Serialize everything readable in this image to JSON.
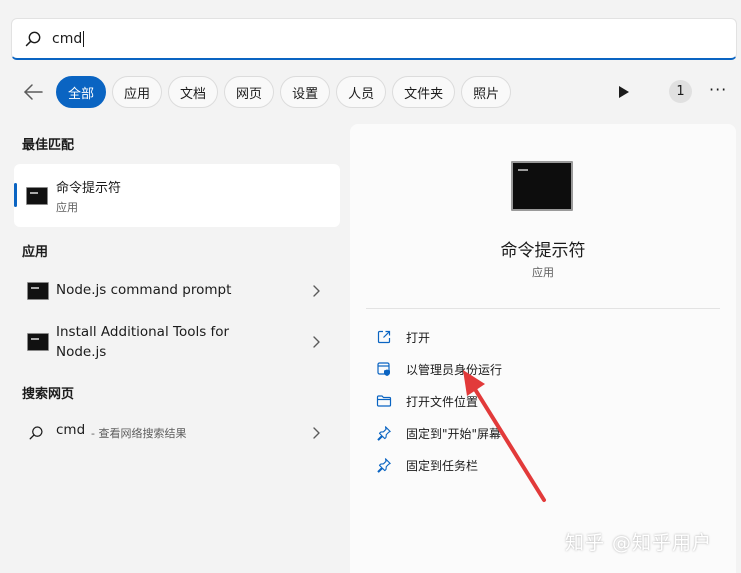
{
  "search": {
    "value": "cmd"
  },
  "filters": {
    "chips": [
      {
        "label": "全部",
        "active": true
      },
      {
        "label": "应用"
      },
      {
        "label": "文档"
      },
      {
        "label": "网页"
      },
      {
        "label": "设置"
      },
      {
        "label": "人员"
      },
      {
        "label": "文件夹"
      },
      {
        "label": "照片"
      }
    ],
    "count": "1",
    "more": "···"
  },
  "sections": {
    "best_match": "最佳匹配",
    "apps": "应用",
    "web": "搜索网页"
  },
  "best_match": {
    "name": "命令提示符",
    "type": "应用"
  },
  "apps": [
    {
      "name": "Node.js command prompt"
    },
    {
      "name_line1": "Install Additional Tools for",
      "name_line2": "Node.js"
    }
  ],
  "web_result": {
    "query": "cmd",
    "hint": "- 查看网络搜索结果"
  },
  "detail": {
    "name": "命令提示符",
    "type": "应用",
    "actions": [
      {
        "label": "打开",
        "icon": "open-external-icon"
      },
      {
        "label": "以管理员身份运行",
        "icon": "shield-admin-icon"
      },
      {
        "label": "打开文件位置",
        "icon": "folder-icon"
      },
      {
        "label": "固定到\"开始\"屏幕",
        "icon": "pin-icon"
      },
      {
        "label": "固定到任务栏",
        "icon": "pin-icon"
      }
    ]
  },
  "watermark": "知乎 @知乎用户",
  "colors": {
    "accent": "#0a64c2",
    "annotation_arrow": "#e23a3a"
  }
}
